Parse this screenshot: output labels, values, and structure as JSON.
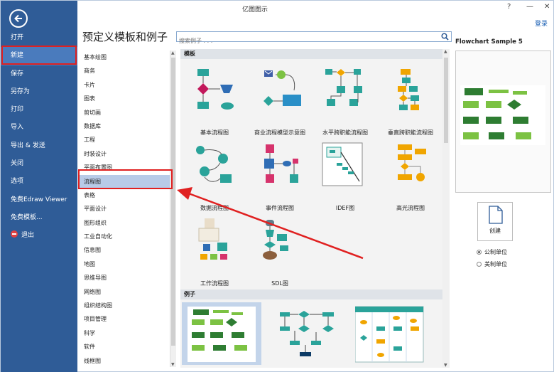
{
  "window": {
    "title": "亿图图示",
    "login_label": "登录"
  },
  "sidebar": {
    "items": [
      {
        "label": "打开"
      },
      {
        "label": "新建"
      },
      {
        "label": "保存"
      },
      {
        "label": "另存为"
      },
      {
        "label": "打印"
      },
      {
        "label": "导入"
      },
      {
        "label": "导出 & 发送"
      },
      {
        "label": "关闭"
      },
      {
        "label": "选项"
      },
      {
        "label": "免费Edraw Viewer"
      },
      {
        "label": "免费模板..."
      },
      {
        "label": "退出"
      }
    ],
    "active_index": 1
  },
  "main": {
    "heading": "预定义模板和例子",
    "search_placeholder": "搜索例子 . . ."
  },
  "categories": [
    "基本绘图",
    "商务",
    "卡片",
    "图表",
    "剪切画",
    "数据库",
    "工程",
    "时装设计",
    "平面布置图",
    "流程图",
    "表格",
    "平面设计",
    "图形组织",
    "工业自动化",
    "信息图",
    "地图",
    "思维导图",
    "网络图",
    "组织结构图",
    "项目管理",
    "科学",
    "软件",
    "线框图"
  ],
  "selected_category": "流程图",
  "gallery": {
    "templates_header": "模板",
    "examples_header": "例子",
    "templates": [
      {
        "label": "基本流程图"
      },
      {
        "label": "商业流程模型示意图"
      },
      {
        "label": "水平跨职能流程图"
      },
      {
        "label": "垂直跨职能流程图"
      },
      {
        "label": "数据流程图"
      },
      {
        "label": "事件流程图"
      },
      {
        "label": "IDEF图"
      },
      {
        "label": "高光流程图"
      },
      {
        "label": "工作流程图"
      },
      {
        "label": "SDL图"
      }
    ]
  },
  "preview": {
    "title": "Flowchart Sample 5",
    "create_label": "创建",
    "units": [
      {
        "label": "公制单位",
        "checked": true
      },
      {
        "label": "美制单位",
        "checked": false
      }
    ]
  },
  "colors": {
    "rail": "#2f5c97",
    "accent_red": "#e02020",
    "teal": "#2aa39a",
    "green": "#4caf50"
  }
}
